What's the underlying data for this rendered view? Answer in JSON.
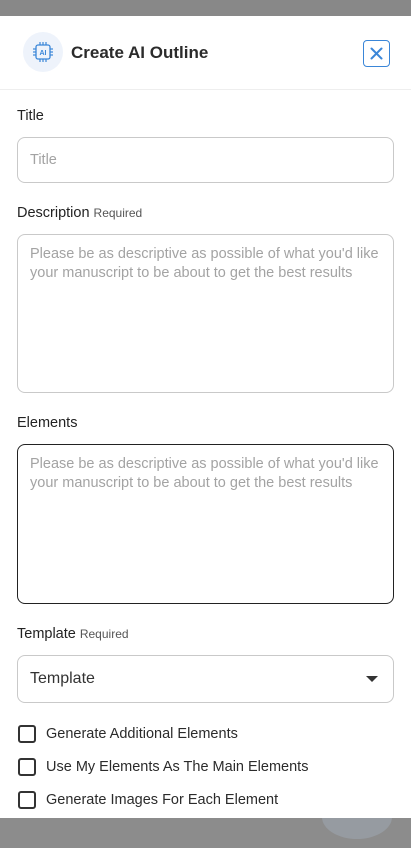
{
  "modal": {
    "title": "Create AI Outline",
    "badge_text": "AI"
  },
  "fields": {
    "title": {
      "label": "Title",
      "placeholder": "Title",
      "value": ""
    },
    "description": {
      "label": "Description",
      "required_text": "Required",
      "placeholder": "Please be as descriptive as possible of what you'd like your manuscript to be about to get the best results",
      "value": ""
    },
    "elements": {
      "label": "Elements",
      "placeholder": "Please be as descriptive as possible of what you'd like your manuscript to be about to get the best results",
      "value": ""
    },
    "template": {
      "label": "Template",
      "required_text": "Required",
      "selected": "Template"
    }
  },
  "options": [
    {
      "label": "Generate Additional Elements",
      "checked": false
    },
    {
      "label": "Use My Elements As The Main Elements",
      "checked": false
    },
    {
      "label": "Generate Images For Each Element",
      "checked": false
    }
  ],
  "colors": {
    "accent": "#3a86d8",
    "backdrop": "#8a8a8a"
  },
  "icons": {
    "badge": "ai-chip-icon",
    "close": "close-icon",
    "dropdown": "caret-down-icon"
  }
}
